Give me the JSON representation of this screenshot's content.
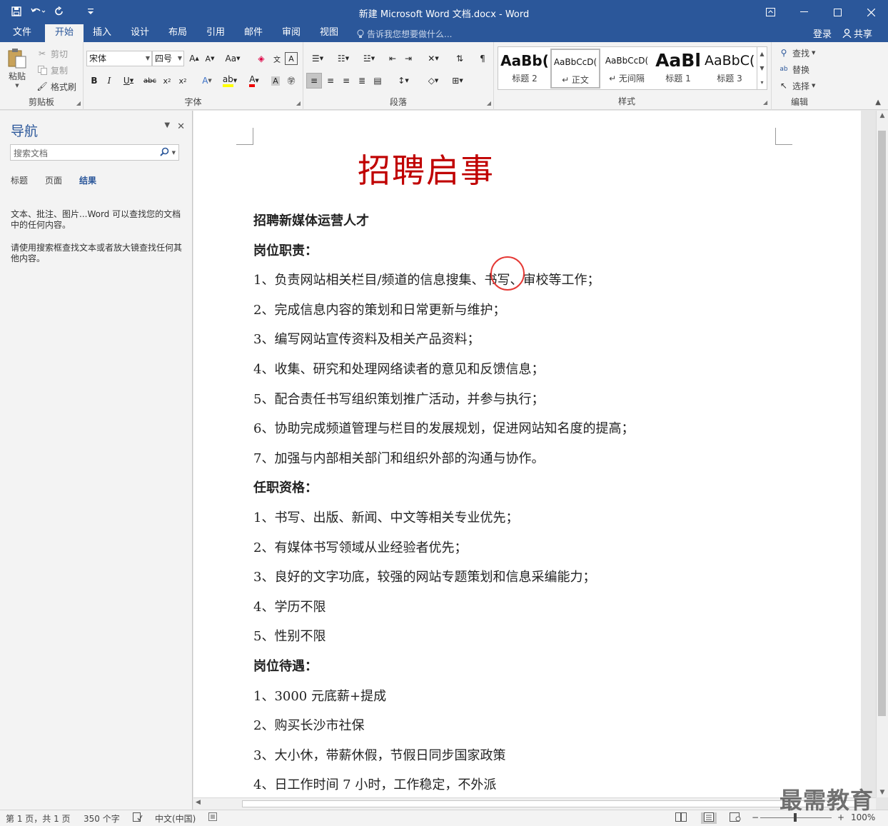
{
  "window": {
    "title": "新建 Microsoft Word 文档.docx - Word",
    "qat": [
      "save-icon",
      "undo-icon",
      "redo-icon",
      "customize-icon"
    ],
    "controls": [
      "ribbon-display-icon",
      "minimize-icon",
      "maximize-icon",
      "close-icon"
    ]
  },
  "tabs": {
    "items": [
      "文件",
      "开始",
      "插入",
      "设计",
      "布局",
      "引用",
      "邮件",
      "审阅",
      "视图"
    ],
    "active": "开始",
    "tell_me": "告诉我您想要做什么...",
    "login": "登录",
    "share": "共享"
  },
  "ribbon": {
    "clipboard": {
      "paste": "粘贴",
      "cut": "剪切",
      "copy": "复制",
      "format_painter": "格式刷",
      "label": "剪贴板"
    },
    "font": {
      "name": "宋体",
      "size": "四号",
      "label": "字体"
    },
    "paragraph": {
      "label": "段落"
    },
    "styles": {
      "label": "样式",
      "items": [
        {
          "sample": "AaBb(",
          "name": "标题 2"
        },
        {
          "sample": "AaBbCcD(",
          "name": "↵ 正文"
        },
        {
          "sample": "AaBbCcD(",
          "name": "↵ 无间隔"
        },
        {
          "sample": "AaBl",
          "name": "标题 1"
        },
        {
          "sample": "AaBbC(",
          "name": "标题 3"
        }
      ],
      "selected_index": 1
    },
    "editing": {
      "find": "查找",
      "replace": "替换",
      "select": "选择",
      "label": "编辑"
    }
  },
  "nav": {
    "title": "导航",
    "search_placeholder": "搜索文档",
    "tabs": [
      "标题",
      "页面",
      "结果"
    ],
    "active_tab": "结果",
    "hint1": "文本、批注、图片...Word 可以查找您的文档中的任何内容。",
    "hint2": "请使用搜索框查找文本或者放大镜查找任何其他内容。"
  },
  "document": {
    "title": "招聘启事",
    "lines": [
      {
        "text": "招聘新媒体运营人才",
        "bold": true
      },
      {
        "text": "岗位职责：",
        "bold": true
      },
      {
        "text": "1、负责网站相关栏目/频道的信息搜集、书写、审校等工作；",
        "bold": false
      },
      {
        "text": "2、完成信息内容的策划和日常更新与维护；",
        "bold": false
      },
      {
        "text": "3、编写网站宣传资料及相关产品资料；",
        "bold": false
      },
      {
        "text": "4、收集、研究和处理网络读者的意见和反馈信息；",
        "bold": false
      },
      {
        "text": "5、配合责任书写组织策划推广活动，并参与执行；",
        "bold": false
      },
      {
        "text": "6、协助完成频道管理与栏目的发展规划，促进网站知名度的提高；",
        "bold": false
      },
      {
        "text": "7、加强与内部相关部门和组织外部的沟通与协作。",
        "bold": false
      },
      {
        "text": "任职资格：",
        "bold": true
      },
      {
        "text": "1、书写、出版、新闻、中文等相关专业优先；",
        "bold": false
      },
      {
        "text": "2、有媒体书写领域从业经验者优先；",
        "bold": false
      },
      {
        "text": "3、良好的文字功底，较强的网站专题策划和信息采编能力；",
        "bold": false
      },
      {
        "text": "4、学历不限",
        "bold": false
      },
      {
        "text": "5、性别不限",
        "bold": false
      },
      {
        "text": "岗位待遇：",
        "bold": true
      },
      {
        "text": "1、3000 元底薪+提成",
        "bold": false
      },
      {
        "text": "2、购买长沙市社保",
        "bold": false
      },
      {
        "text": "3、大小休，带薪休假，节假日同步国家政策",
        "bold": false
      },
      {
        "text": "4、日工作时间 7 小时，工作稳定，不外派",
        "bold": false
      }
    ],
    "highlight_color": "#e53935"
  },
  "status": {
    "page": "第 1 页，共 1 页",
    "words": "350 个字",
    "language": "中文(中国)",
    "zoom": "100%",
    "watermark": "最需教育"
  },
  "colors": {
    "accent": "#2b579a",
    "title_red": "#c00000"
  }
}
